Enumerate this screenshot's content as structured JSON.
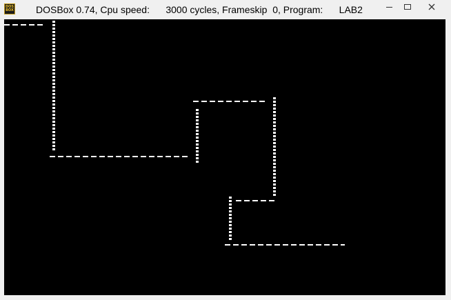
{
  "window": {
    "title_parts": [
      "DOSBox 0.74, Cpu speed:",
      "3000 cycles, Frameskip",
      "0, Program:",
      "LAB2"
    ],
    "icon_label_top": "DOS",
    "icon_label_bottom": "BOX"
  },
  "controls": {
    "minimize_icon": "minimize-icon",
    "maximize_icon": "maximize-icon",
    "close_icon": "close-icon"
  },
  "screen": {
    "background": "#000000",
    "line_color": "#ffffff"
  }
}
